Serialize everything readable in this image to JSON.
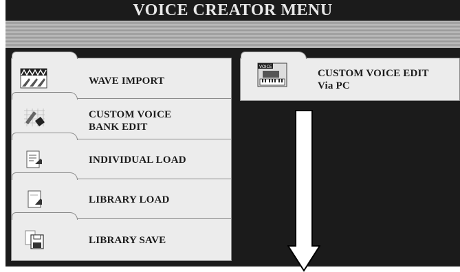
{
  "header": {
    "title": "VOICE CREATOR MENU"
  },
  "menu": {
    "items": [
      {
        "label": "WAVE IMPORT",
        "icon": "wave-import-icon"
      },
      {
        "label_line1": "CUSTOM VOICE",
        "label_line2": "BANK EDIT",
        "icon": "custom-voice-bank-edit-icon"
      },
      {
        "label": "INDIVIDUAL LOAD",
        "icon": "individual-load-icon"
      },
      {
        "label": "LIBRARY LOAD",
        "icon": "library-load-icon"
      },
      {
        "label": "LIBRARY SAVE",
        "icon": "library-save-icon"
      }
    ]
  },
  "right_panel": {
    "label_line1": "CUSTOM VOICE EDIT",
    "label_line2": "Via PC",
    "icon": "voice-keyboard-icon",
    "icon_text": "VOICE"
  },
  "colors": {
    "background": "#1b1b1b",
    "tab": "#ececec",
    "title_text": "#e8e8e8"
  }
}
